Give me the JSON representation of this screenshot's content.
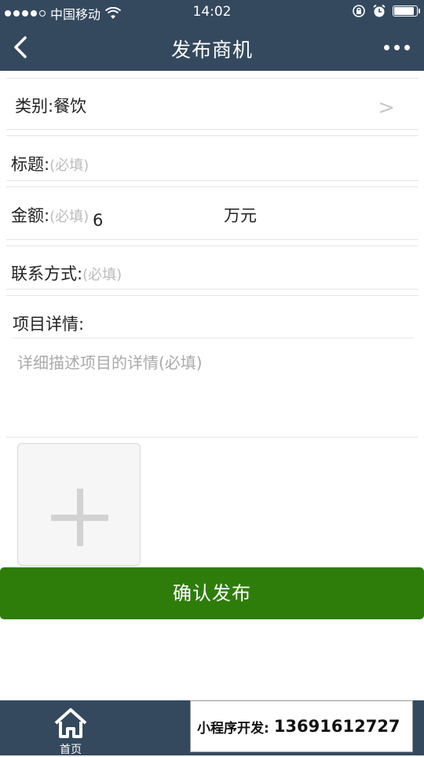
{
  "status_bar": {
    "carrier": "中国移动",
    "time": "14:02"
  },
  "nav": {
    "title": "发布商机"
  },
  "form": {
    "category_label": "类别:",
    "category_value": "餐饮",
    "category_chevron": ">",
    "title_label": "标题:",
    "title_placeholder": "(必填)",
    "amount_label": "金额:",
    "amount_placeholder": "(必填)",
    "amount_value": "6",
    "amount_unit": "万元",
    "contact_label": "联系方式:",
    "contact_placeholder": "(必填)",
    "details_label": "项目详情:",
    "details_placeholder": "详细描述项目的详情(必填)"
  },
  "submit_label": "确认发布",
  "tabbar": {
    "home_label": "首页"
  },
  "promo": {
    "prefix": "小程序开发:",
    "phone": "13691612727"
  },
  "colors": {
    "header": "#34495e",
    "submit": "#2e7d0a",
    "placeholder": "#bbbbbb"
  }
}
